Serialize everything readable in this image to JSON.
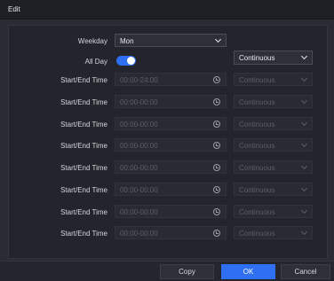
{
  "dialog": {
    "title": "Edit"
  },
  "weekday": {
    "label": "Weekday",
    "value": "Mon"
  },
  "all_day": {
    "label": "All Day",
    "enabled": true,
    "mode": "Continuous"
  },
  "rows": [
    {
      "label": "Start/End Time",
      "time": "00:00-24:00",
      "mode": "Continuous"
    },
    {
      "label": "Start/End Time",
      "time": "00:00-00:00",
      "mode": "Continuous"
    },
    {
      "label": "Start/End Time",
      "time": "00:00-00:00",
      "mode": "Continuous"
    },
    {
      "label": "Start/End Time",
      "time": "00:00-00:00",
      "mode": "Continuous"
    },
    {
      "label": "Start/End Time",
      "time": "00:00-00:00",
      "mode": "Continuous"
    },
    {
      "label": "Start/End Time",
      "time": "00:00-00:00",
      "mode": "Continuous"
    },
    {
      "label": "Start/End Time",
      "time": "00:00-00:00",
      "mode": "Continuous"
    },
    {
      "label": "Start/End Time",
      "time": "00:00-00:00",
      "mode": "Continuous"
    }
  ],
  "buttons": {
    "copy": "Copy",
    "ok": "OK",
    "cancel": "Cancel"
  },
  "colors": {
    "accent": "#2f6ff2",
    "background": "#2a2b33"
  }
}
